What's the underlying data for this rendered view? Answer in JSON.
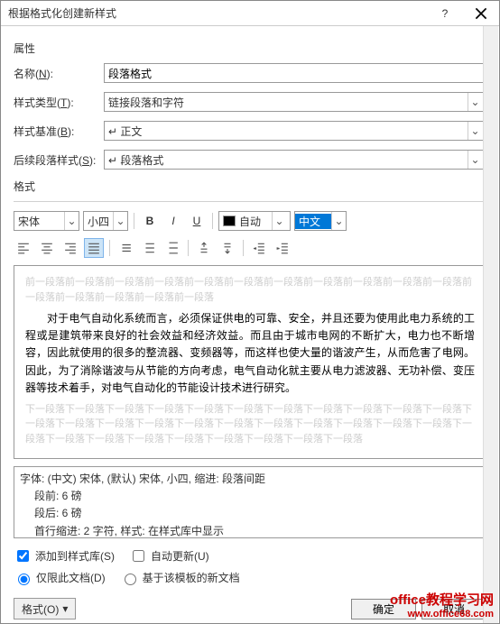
{
  "titlebar": {
    "title": "根据格式化创建新样式"
  },
  "sections": {
    "properties": "属性",
    "format": "格式"
  },
  "labels": {
    "name": "名称(N):",
    "styleType": "样式类型(T):",
    "styleBase": "样式基准(B):",
    "nextPara": "后续段落样式(S):"
  },
  "values": {
    "name": "段落格式",
    "styleType": "链接段落和字符",
    "styleBase": "↵ 正文",
    "nextPara": "↵ 段落格式"
  },
  "toolbar": {
    "font": "宋体",
    "size": "小四",
    "color": "自动",
    "lang": "中文"
  },
  "preview": {
    "ghost1": "前一段落前一段落前一段落前一段落前一段落前一段落前一段落前一段落前一段落前一段落前一段落前一段落前一段落前一段落前一段落前一段落",
    "body": "对于电气自动化系统而言，必须保证供电的可靠、安全，并且还要为使用此电力系统的工程或是建筑带来良好的社会效益和经济效益。而且由于城市电网的不断扩大，电力也不断增容，因此就使用的很多的整流器、变频器等，而这样也使大量的谐波产生，从而危害了电网。因此，为了消除谐波与从节能的方向考虑，电气自动化就主要从电力滤波器、无功补偿、变压器等技术着手，对电气自动化的节能设计技术进行研究。",
    "ghost2": "下一段落下一段落下一段落下一段落下一段落下一段落下一段落下一段落下一段落下一段落下一段落下一段落下一段落下一段落下一段落下一段落下一段落下一段落下一段落下一段落下一段落下一段落下一段落下一段落下一段落下一段落下一段落下一段落下一段落下一段落下一段落"
  },
  "description": {
    "line1": "字体: (中文) 宋体, (默认) 宋体, 小四, 缩进: 段落间距",
    "line2": "段前: 6 磅",
    "line3": "段后: 6 磅",
    "line4": "首行缩进:  2 字符, 样式: 在样式库中显示"
  },
  "checkboxes": {
    "addToGallery": "添加到样式库(S)",
    "autoUpdate": "自动更新(U)"
  },
  "radios": {
    "thisDoc": "仅限此文档(D)",
    "template": "基于该模板的新文档"
  },
  "buttons": {
    "format": "格式(O)",
    "ok": "确定",
    "cancel": "取消"
  },
  "watermark": {
    "main": "office教程学习网",
    "sub": "www.office68.com"
  }
}
